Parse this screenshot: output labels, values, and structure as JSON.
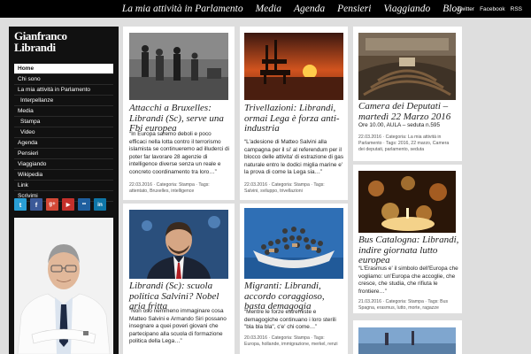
{
  "topnav": {
    "items": [
      "La mia attività in Parlamento",
      "Media",
      "Agenda",
      "Pensieri",
      "Viaggiando",
      "Blog"
    ],
    "social": [
      "Twitter",
      "Facebook",
      "RSS"
    ]
  },
  "logo": {
    "line1": "Gianfranco",
    "line2": "Librandi"
  },
  "sidebar": {
    "menu": [
      {
        "label": "Home"
      },
      {
        "label": "Chi sono"
      },
      {
        "label": "La mia attività in Parlamento"
      },
      {
        "label": "Interpellanze"
      },
      {
        "label": "Media"
      },
      {
        "label": "Stampa"
      },
      {
        "label": "Video"
      },
      {
        "label": "Agenda"
      },
      {
        "label": "Pensieri"
      },
      {
        "label": "Viaggiando"
      },
      {
        "label": "Wikipedia"
      },
      {
        "label": "Link"
      },
      {
        "label": "Scrivimi"
      }
    ],
    "social_icons": [
      "twitter-icon",
      "facebook-icon",
      "google-plus-icon",
      "youtube-icon",
      "flickr-icon",
      "linkedin-icon"
    ]
  },
  "posts": [
    {
      "title": "Attacchi a Bruxelles: Librandi (Sc), serve una Fbi europea",
      "excerpt": "“In Europa saremo deboli e poco efficaci nella lotta contro il terrorismo islamista se continueremo ad illuderci di poter far lavorare 28 agenzie di intelligence diverse senza un reale e concreto coordinamento tra loro…”",
      "date": "22.03.2016",
      "meta_line1": "22.03.2016 · Categoria: Stampa · Tags:",
      "meta_line2": "attentato, Bruxelles, intelligence"
    },
    {
      "title": "Trivellazioni: Librandi, ormai Lega è forza anti-industria",
      "excerpt": "“L'adesione di Matteo Salvini alla campagna per il si' al referendum per il blocco delle attivita' di estrazione di gas naturale entro le dodici miglia marine e' la prova di come la Lega sia…”",
      "date": "22.03.2016",
      "meta_line1": "22.03.2016 · Categoria: Stampa · Tags:",
      "meta_line2": "Salvini, sviluppo, trivellazioni"
    },
    {
      "title": "Camera dei Deputati – martedì 22 Marzo 2016",
      "excerpt": "Ore 10.00, AULA – seduta n.595",
      "date": "22.03.2016",
      "meta_line1": "22.03.2016 · Categoria: La mia attività in",
      "meta_line2": "Parlamento · Tags: 2016, 22 marzo, Camera",
      "meta_line3": "dei deputati, parlamento, seduta"
    },
    {
      "title": "Bus Catalogna: Librandi, indire giornata lutto europea",
      "excerpt": "“L'Erasmus e' il simbolo dell'Europa che vogliamo: un'Europa che accoglie, che cresce, che studia, che rifiuta le frontiere…”",
      "date": "21.03.2016",
      "meta_line1": "21.03.2016 · Categoria: Stampa · Tags: Bus",
      "meta_line2": "Spagna, erasmus, lutto, morte, ragazze"
    },
    {
      "title": "Librandi (Sc): scuola politica Salvini? Nobel aria fritta",
      "excerpt": "“Non oso nemmeno immaginare cosa Matteo Salvini e Armando Siri possano insegnare a quei poveri giovani che partecipano alla scuola di formazione politica della Lega…”"
    },
    {
      "title": "Migranti: Librandi, accordo coraggioso, basta demagogia",
      "excerpt": "“Mentre le forze estremiste e demagogiche continuano i loro sterili \"bla bla bla\", c'e' chi come…”",
      "date": "20.03.2016",
      "meta_line1": "20.03.2016 · Categoria: Stampa · Tags:",
      "meta_line2": "Europa, hollande, immigrazione, merkel, renzi"
    }
  ]
}
